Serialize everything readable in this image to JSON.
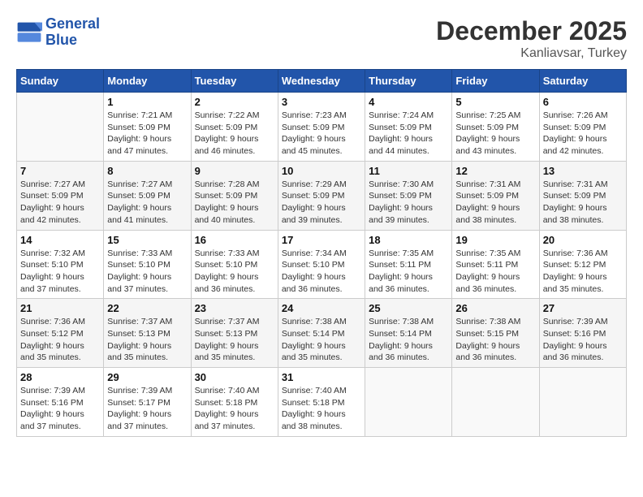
{
  "header": {
    "logo_line1": "General",
    "logo_line2": "Blue",
    "month": "December 2025",
    "location": "Kanliavsar, Turkey"
  },
  "weekdays": [
    "Sunday",
    "Monday",
    "Tuesday",
    "Wednesday",
    "Thursday",
    "Friday",
    "Saturday"
  ],
  "weeks": [
    [
      {
        "day": "",
        "info": ""
      },
      {
        "day": "1",
        "info": "Sunrise: 7:21 AM\nSunset: 5:09 PM\nDaylight: 9 hours\nand 47 minutes."
      },
      {
        "day": "2",
        "info": "Sunrise: 7:22 AM\nSunset: 5:09 PM\nDaylight: 9 hours\nand 46 minutes."
      },
      {
        "day": "3",
        "info": "Sunrise: 7:23 AM\nSunset: 5:09 PM\nDaylight: 9 hours\nand 45 minutes."
      },
      {
        "day": "4",
        "info": "Sunrise: 7:24 AM\nSunset: 5:09 PM\nDaylight: 9 hours\nand 44 minutes."
      },
      {
        "day": "5",
        "info": "Sunrise: 7:25 AM\nSunset: 5:09 PM\nDaylight: 9 hours\nand 43 minutes."
      },
      {
        "day": "6",
        "info": "Sunrise: 7:26 AM\nSunset: 5:09 PM\nDaylight: 9 hours\nand 42 minutes."
      }
    ],
    [
      {
        "day": "7",
        "info": "Sunrise: 7:27 AM\nSunset: 5:09 PM\nDaylight: 9 hours\nand 42 minutes."
      },
      {
        "day": "8",
        "info": "Sunrise: 7:27 AM\nSunset: 5:09 PM\nDaylight: 9 hours\nand 41 minutes."
      },
      {
        "day": "9",
        "info": "Sunrise: 7:28 AM\nSunset: 5:09 PM\nDaylight: 9 hours\nand 40 minutes."
      },
      {
        "day": "10",
        "info": "Sunrise: 7:29 AM\nSunset: 5:09 PM\nDaylight: 9 hours\nand 39 minutes."
      },
      {
        "day": "11",
        "info": "Sunrise: 7:30 AM\nSunset: 5:09 PM\nDaylight: 9 hours\nand 39 minutes."
      },
      {
        "day": "12",
        "info": "Sunrise: 7:31 AM\nSunset: 5:09 PM\nDaylight: 9 hours\nand 38 minutes."
      },
      {
        "day": "13",
        "info": "Sunrise: 7:31 AM\nSunset: 5:09 PM\nDaylight: 9 hours\nand 38 minutes."
      }
    ],
    [
      {
        "day": "14",
        "info": "Sunrise: 7:32 AM\nSunset: 5:10 PM\nDaylight: 9 hours\nand 37 minutes."
      },
      {
        "day": "15",
        "info": "Sunrise: 7:33 AM\nSunset: 5:10 PM\nDaylight: 9 hours\nand 37 minutes."
      },
      {
        "day": "16",
        "info": "Sunrise: 7:33 AM\nSunset: 5:10 PM\nDaylight: 9 hours\nand 36 minutes."
      },
      {
        "day": "17",
        "info": "Sunrise: 7:34 AM\nSunset: 5:10 PM\nDaylight: 9 hours\nand 36 minutes."
      },
      {
        "day": "18",
        "info": "Sunrise: 7:35 AM\nSunset: 5:11 PM\nDaylight: 9 hours\nand 36 minutes."
      },
      {
        "day": "19",
        "info": "Sunrise: 7:35 AM\nSunset: 5:11 PM\nDaylight: 9 hours\nand 36 minutes."
      },
      {
        "day": "20",
        "info": "Sunrise: 7:36 AM\nSunset: 5:12 PM\nDaylight: 9 hours\nand 35 minutes."
      }
    ],
    [
      {
        "day": "21",
        "info": "Sunrise: 7:36 AM\nSunset: 5:12 PM\nDaylight: 9 hours\nand 35 minutes."
      },
      {
        "day": "22",
        "info": "Sunrise: 7:37 AM\nSunset: 5:13 PM\nDaylight: 9 hours\nand 35 minutes."
      },
      {
        "day": "23",
        "info": "Sunrise: 7:37 AM\nSunset: 5:13 PM\nDaylight: 9 hours\nand 35 minutes."
      },
      {
        "day": "24",
        "info": "Sunrise: 7:38 AM\nSunset: 5:14 PM\nDaylight: 9 hours\nand 35 minutes."
      },
      {
        "day": "25",
        "info": "Sunrise: 7:38 AM\nSunset: 5:14 PM\nDaylight: 9 hours\nand 36 minutes."
      },
      {
        "day": "26",
        "info": "Sunrise: 7:38 AM\nSunset: 5:15 PM\nDaylight: 9 hours\nand 36 minutes."
      },
      {
        "day": "27",
        "info": "Sunrise: 7:39 AM\nSunset: 5:16 PM\nDaylight: 9 hours\nand 36 minutes."
      }
    ],
    [
      {
        "day": "28",
        "info": "Sunrise: 7:39 AM\nSunset: 5:16 PM\nDaylight: 9 hours\nand 37 minutes."
      },
      {
        "day": "29",
        "info": "Sunrise: 7:39 AM\nSunset: 5:17 PM\nDaylight: 9 hours\nand 37 minutes."
      },
      {
        "day": "30",
        "info": "Sunrise: 7:40 AM\nSunset: 5:18 PM\nDaylight: 9 hours\nand 37 minutes."
      },
      {
        "day": "31",
        "info": "Sunrise: 7:40 AM\nSunset: 5:18 PM\nDaylight: 9 hours\nand 38 minutes."
      },
      {
        "day": "",
        "info": ""
      },
      {
        "day": "",
        "info": ""
      },
      {
        "day": "",
        "info": ""
      }
    ]
  ]
}
